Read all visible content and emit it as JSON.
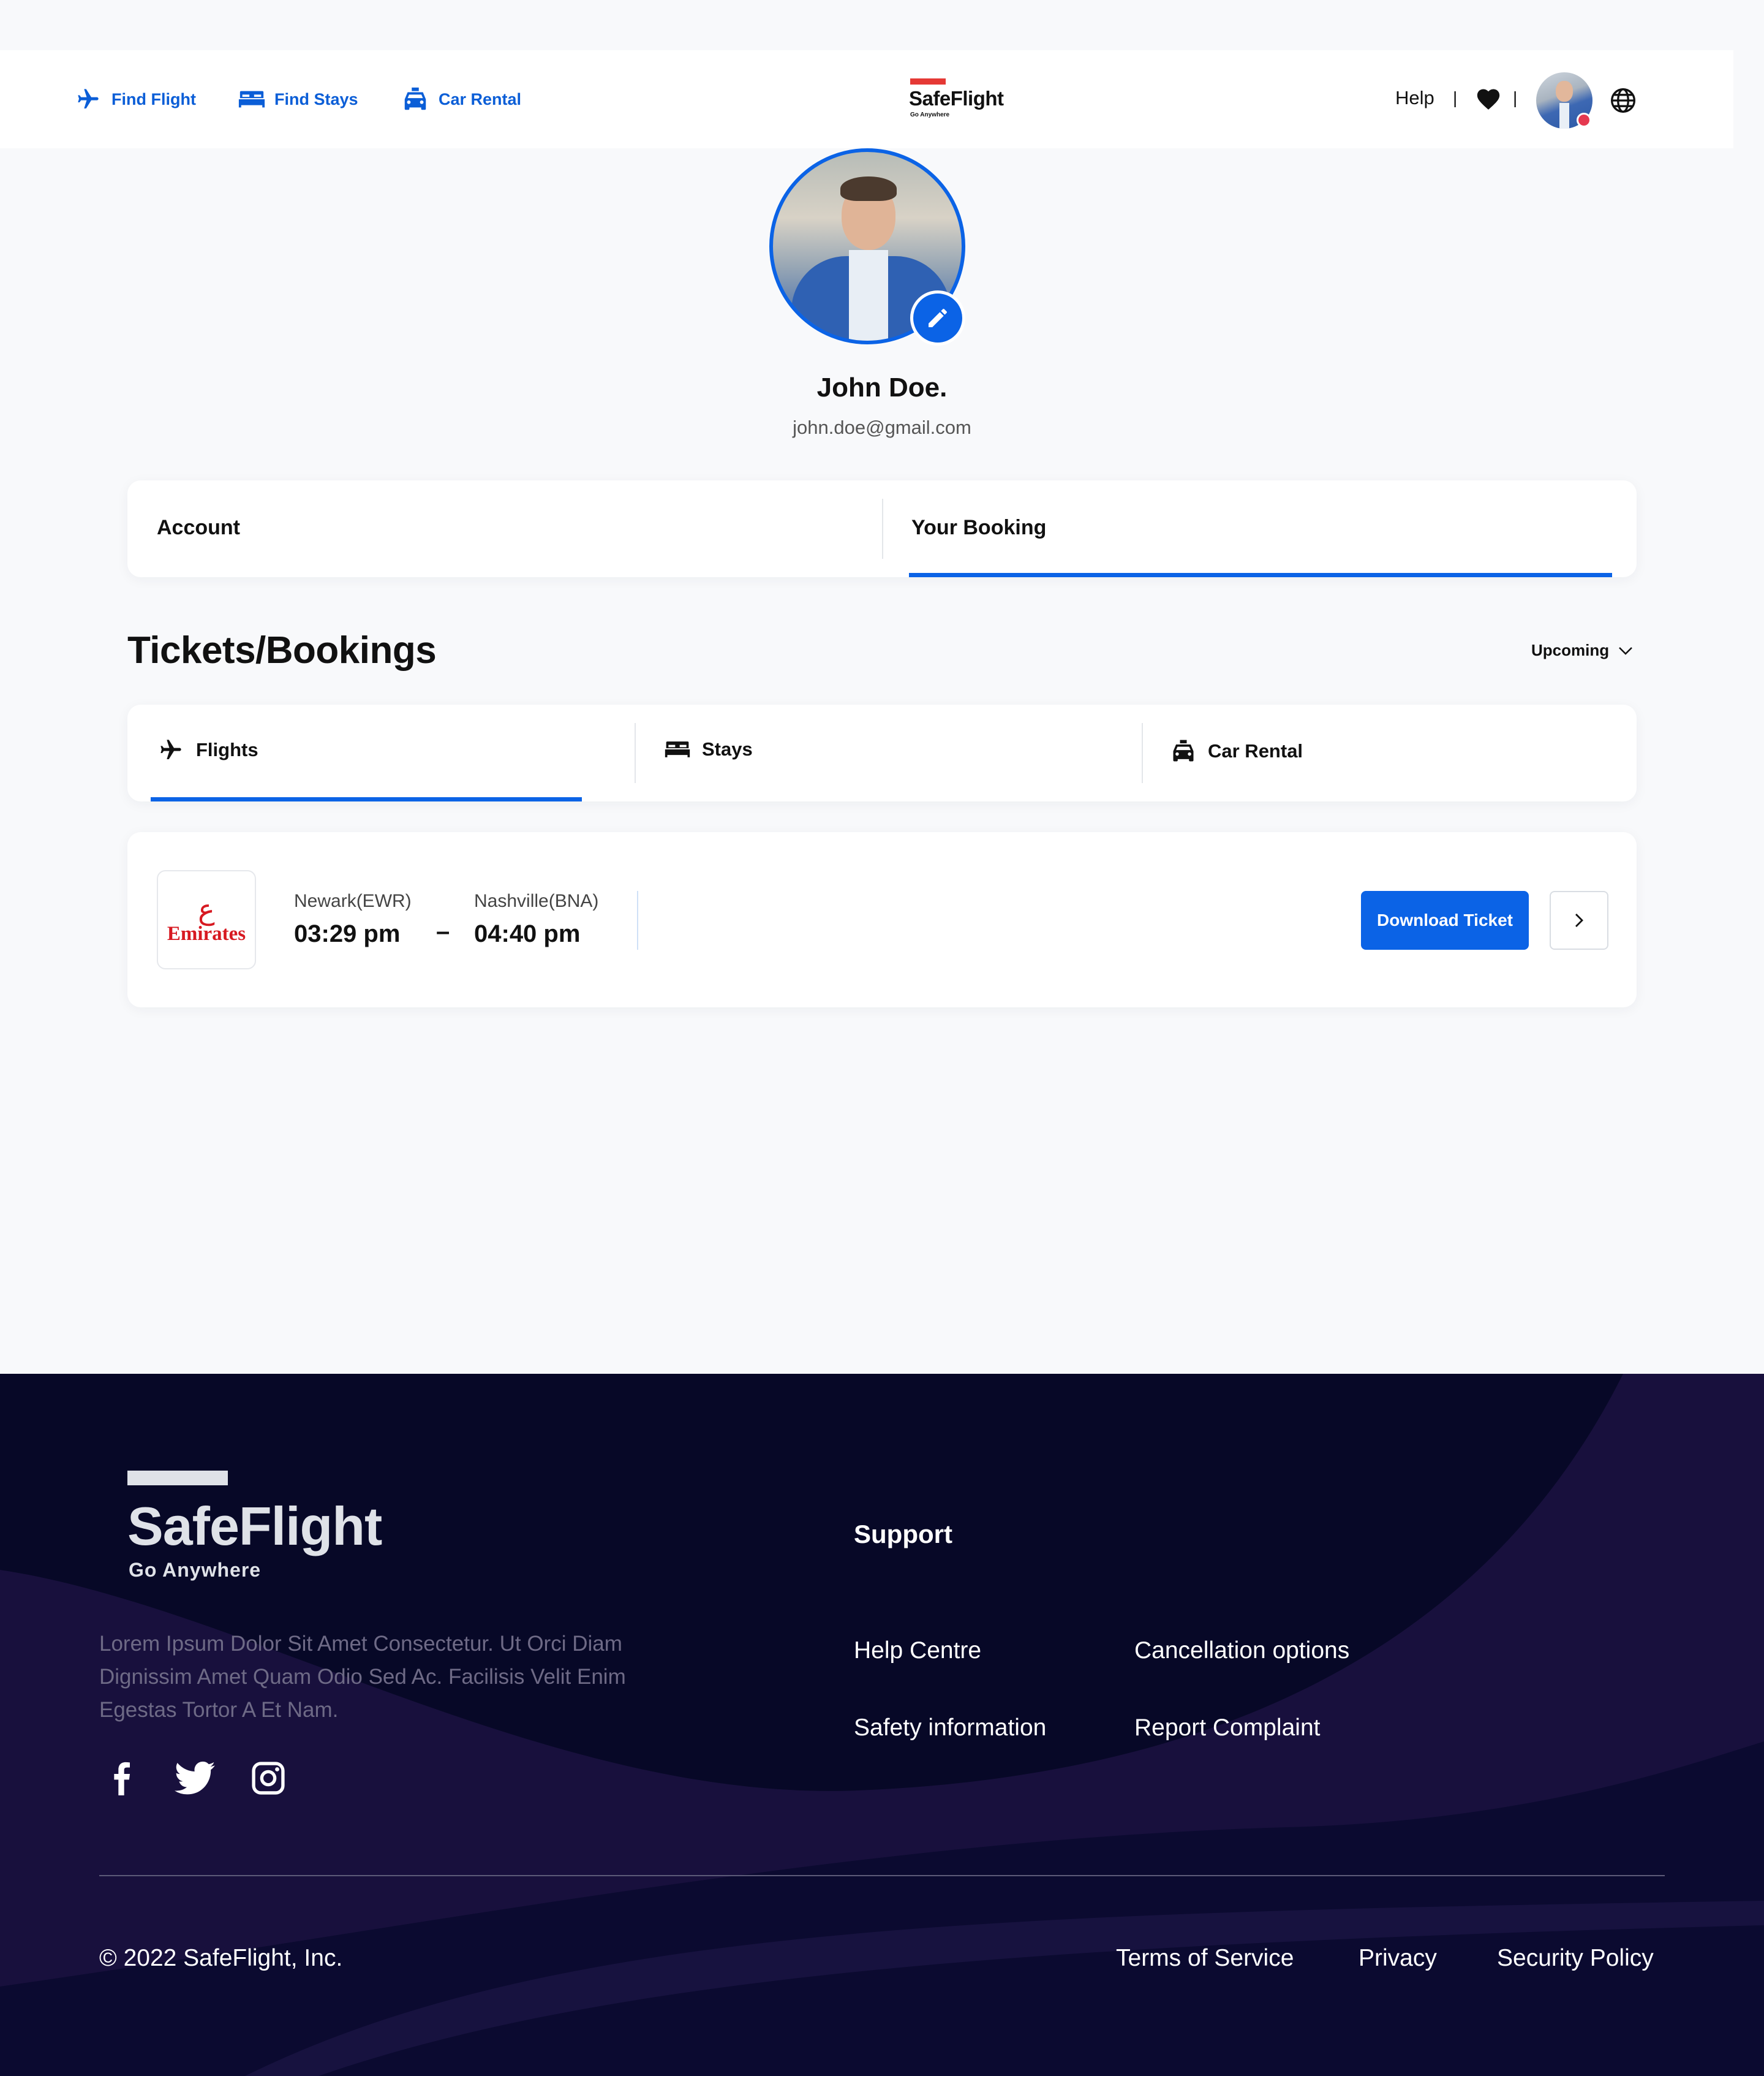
{
  "header": {
    "nav": [
      {
        "label": "Find Flight",
        "icon": "plane-icon"
      },
      {
        "label": "Find Stays",
        "icon": "bed-icon"
      },
      {
        "label": "Car Rental",
        "icon": "car-icon"
      }
    ],
    "brand": {
      "name": "SafeFlight",
      "tagline": "Go Anywhere"
    },
    "help_label": "Help",
    "separator": "|",
    "icons": [
      "heart-icon",
      "avatar",
      "globe-icon"
    ]
  },
  "profile": {
    "name": "John Doe.",
    "email": "john.doe@gmail.com"
  },
  "account_tabs": [
    {
      "label": "Account",
      "active": false
    },
    {
      "label": "Your Booking",
      "active": true
    }
  ],
  "bookings": {
    "title": "Tickets/Bookings",
    "filter": {
      "selected": "Upcoming"
    },
    "categories": [
      {
        "label": "Flights",
        "icon": "plane-icon",
        "active": true
      },
      {
        "label": "Stays",
        "icon": "bed-icon",
        "active": false
      },
      {
        "label": "Car Rental",
        "icon": "car-icon",
        "active": false
      }
    ],
    "items": [
      {
        "airline": "Emirates",
        "airline_script": "ﻉ",
        "from_city": "Newark(EWR)",
        "from_time": "03:29 pm",
        "dash": "–",
        "to_city": "Nashville(BNA)",
        "to_time": "04:40 pm",
        "download_label": "Download Ticket"
      }
    ]
  },
  "footer": {
    "brand": {
      "name": "SafeFlight",
      "tagline": "Go Anywhere"
    },
    "description": "Lorem Ipsum Dolor Sit Amet Consectetur. Ut Orci Diam Dignissim Amet Quam Odio Sed Ac. Facilisis Velit Enim Egestas Tortor A Et Nam.",
    "social": [
      "facebook-icon",
      "twitter-icon",
      "instagram-icon"
    ],
    "support_title": "Support",
    "support_links": [
      "Help Centre",
      "Cancellation options",
      "Safety information",
      "Report Complaint"
    ],
    "copyright": "© 2022 SafeFlight, Inc.",
    "legal_links": [
      "Terms of Service",
      "Privacy",
      "Security Policy"
    ]
  },
  "colors": {
    "accent": "#0b63e6",
    "brand_red": "#e53935",
    "footer_bg": "#070827",
    "emirates_red": "#d71921"
  }
}
